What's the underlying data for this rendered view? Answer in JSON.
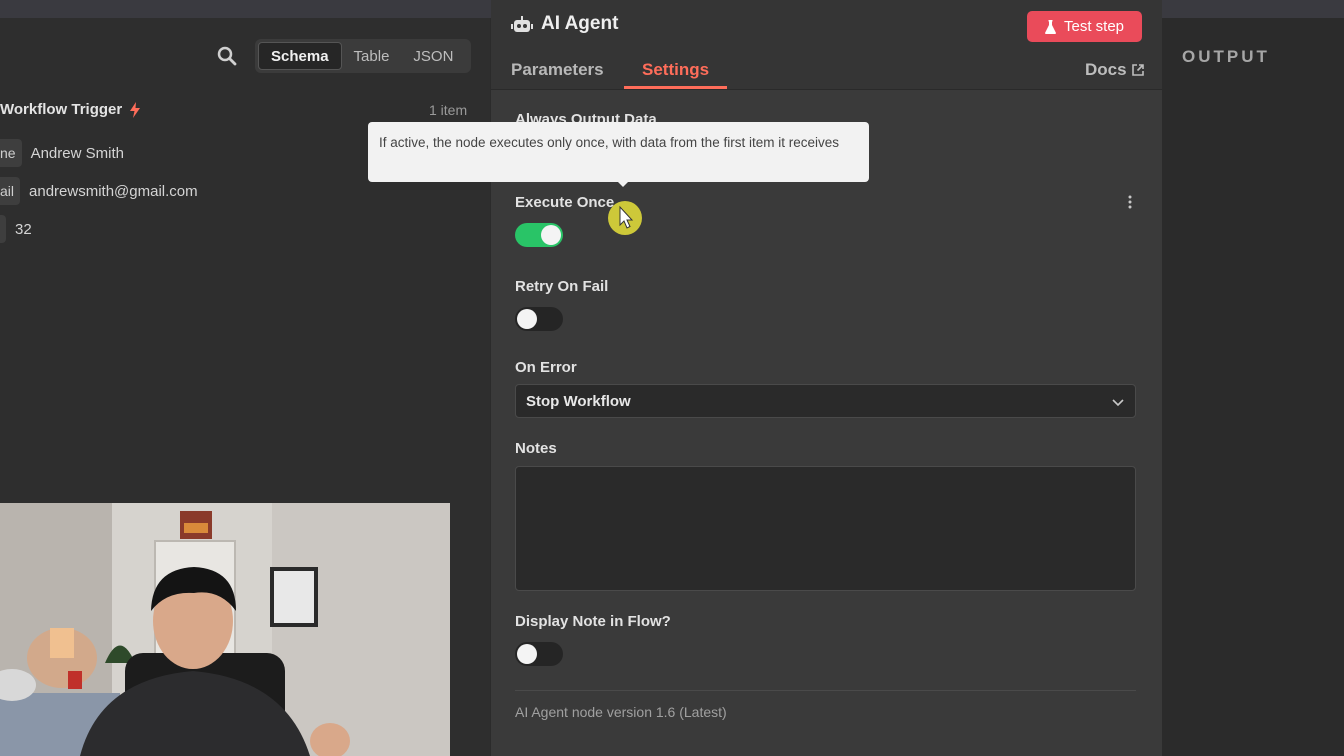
{
  "input_panel": {
    "view_tabs": [
      "Schema",
      "Table",
      "JSON"
    ],
    "active_view": "Schema",
    "trigger_title": "Workflow Trigger",
    "item_count": "1 item",
    "fields": [
      {
        "key": "ne",
        "value": "Andrew Smith"
      },
      {
        "key": "ail",
        "value": "andrewsmith@gmail.com"
      },
      {
        "key": "",
        "value": "32"
      }
    ]
  },
  "node_panel": {
    "title": "AI Agent",
    "test_button": "Test step",
    "tabs": [
      "Parameters",
      "Settings"
    ],
    "active_tab": "Settings",
    "docs_label": "Docs",
    "settings": {
      "always_output_label": "Always Output Data",
      "tooltip": "If active, the node executes only once, with data from the first item it receives",
      "execute_once_label": "Execute Once",
      "execute_once": true,
      "retry_label": "Retry On Fail",
      "retry_on_fail": false,
      "on_error_label": "On Error",
      "on_error_value": "Stop Workflow",
      "notes_label": "Notes",
      "notes_value": "",
      "display_note_label": "Display Note in Flow?",
      "display_note": false
    },
    "version": "AI Agent node version 1.6 (Latest)"
  },
  "output_panel": {
    "title": "OUTPUT"
  },
  "colors": {
    "accent": "#ff6d5a",
    "test_button": "#ea4b5a",
    "toggle_on": "#29c467"
  }
}
